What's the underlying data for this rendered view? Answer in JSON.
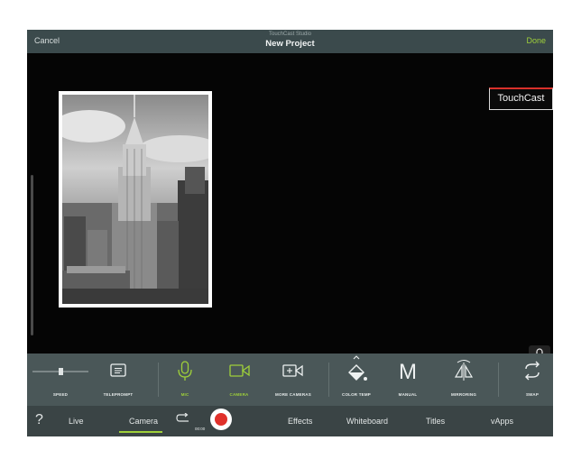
{
  "topbar": {
    "cancel": "Cancel",
    "app_name": "TouchCast Studio",
    "title": "New Project",
    "done": "Done"
  },
  "preview": {
    "logo_text": "TouchCast"
  },
  "toolbar": {
    "speed": "SPEED",
    "teleprompt": "TELEPROMPT",
    "mic": "MIC",
    "camera": "CAMERA",
    "more_cameras": "MORE CAMERAS",
    "color_temp": "COLOR TEMP",
    "manual": "MANUAL",
    "manual_glyph": "M",
    "mirroring": "MIRRORING",
    "swap": "SWAP"
  },
  "tabbar": {
    "help": "?",
    "live": "Live",
    "camera": "Camera",
    "timer": "00:00",
    "effects": "Effects",
    "whiteboard": "Whiteboard",
    "titles": "Titles",
    "vapps": "vApps"
  },
  "colors": {
    "accent": "#9fd03a",
    "record": "#e0312b",
    "topbar": "#3b4a4c",
    "toolbar": "#4a5758"
  }
}
